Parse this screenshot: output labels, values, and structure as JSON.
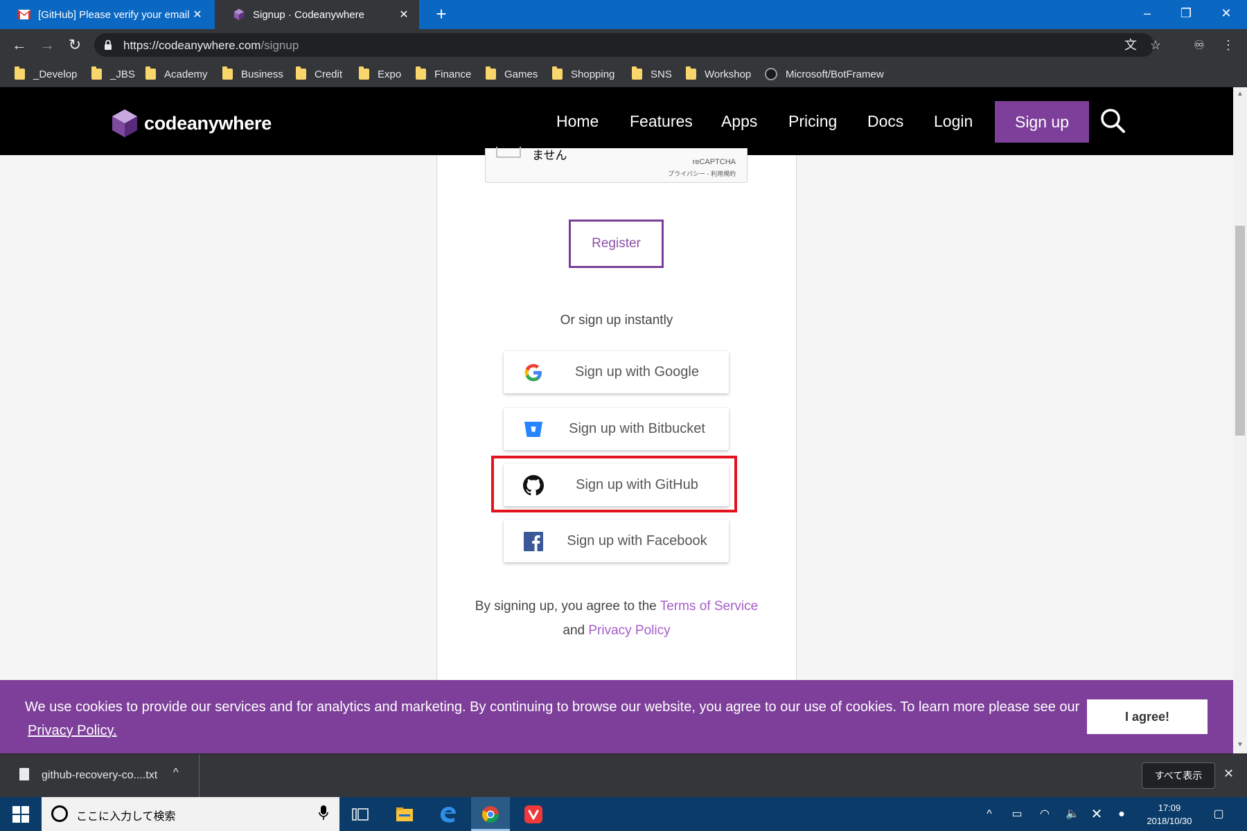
{
  "browser": {
    "tabs": [
      {
        "title": "[GitHub] Please verify your email",
        "icon": "gmail-icon"
      },
      {
        "title": "Signup · Codeanywhere",
        "icon": "codeanywhere-icon"
      }
    ],
    "url_host": "https://codeanywhere.com",
    "url_path": "/signup",
    "bookmarks": [
      "_Develop",
      "_JBS",
      "Academy",
      "Business",
      "Credit",
      "Expo",
      "Finance",
      "Games",
      "Shopping",
      "SNS",
      "Workshop",
      "Microsoft/BotFramew"
    ]
  },
  "site": {
    "brand": "codeanywhere",
    "nav": [
      "Home",
      "Features",
      "Apps",
      "Pricing",
      "Docs",
      "Login"
    ],
    "signup_label": "Sign up",
    "accent_color": "#7d3f9a"
  },
  "signup": {
    "recaptcha_partial": "ません",
    "recaptcha_label": "reCAPTCHA",
    "recaptcha_links": "プライバシー - 利用規約",
    "register_label": "Register",
    "or_text": "Or sign up instantly",
    "social": [
      {
        "label": "Sign up with Google",
        "icon": "google-icon"
      },
      {
        "label": "Sign up with Bitbucket",
        "icon": "bitbucket-icon"
      },
      {
        "label": "Sign up with GitHub",
        "icon": "github-icon"
      },
      {
        "label": "Sign up with Facebook",
        "icon": "facebook-icon"
      }
    ],
    "terms_prefix": "By signing up, you agree to the",
    "terms_link": "Terms of Service",
    "terms_and": "and",
    "privacy_link": "Privacy Policy"
  },
  "cookie": {
    "message": "We use cookies to provide our services and for analytics and marketing. By continuing to browse our website, you agree to our use of cookies. To learn more please see our",
    "privacy_link": "Privacy Policy.",
    "agree_label": "I agree!"
  },
  "downloads": {
    "filename": "github-recovery-co....txt",
    "show_all": "すべて表示"
  },
  "taskbar": {
    "search_placeholder": "ここに入力して検索",
    "time": "17:09",
    "date": "2018/10/30"
  }
}
